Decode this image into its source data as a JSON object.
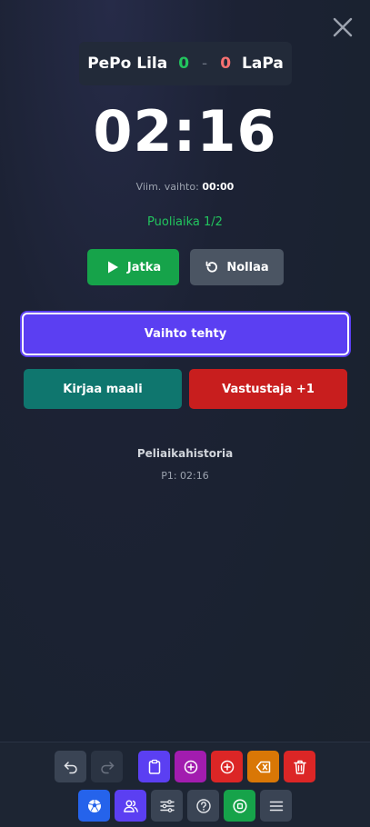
{
  "scoreboard": {
    "home_team": "PePo Lila",
    "home_score": "0",
    "separator": "-",
    "away_score": "0",
    "away_team": "LaPa"
  },
  "timer": {
    "value": "02:16",
    "last_sub_label": "Viim. vaihto:",
    "last_sub_value": "00:00",
    "period": "Puoliaika 1/2"
  },
  "controls": {
    "play_label": "Jatka",
    "reset_label": "Nollaa",
    "substitution_label": "Vaihto tehty",
    "record_goal_label": "Kirjaa maali",
    "opponent_goal_label": "Vastustaja +1"
  },
  "history": {
    "title": "Peliaikahistoria",
    "items": [
      "P1: 02:16"
    ]
  },
  "colors": {
    "green": "#16a34a",
    "gray": "#4b5563",
    "purple": "#5b3ff2",
    "teal": "#0f766e",
    "red": "#c81e1e",
    "orange": "#d97706"
  },
  "toolbar": {
    "row1": [
      "undo-icon",
      "redo-icon",
      "clipboard-icon",
      "plus-circle-icon",
      "plus-circle-icon",
      "backspace-icon",
      "trash-icon"
    ],
    "row2": [
      "soccer-ball-icon",
      "users-icon",
      "sliders-icon",
      "help-icon",
      "stop-icon",
      "menu-icon"
    ]
  }
}
